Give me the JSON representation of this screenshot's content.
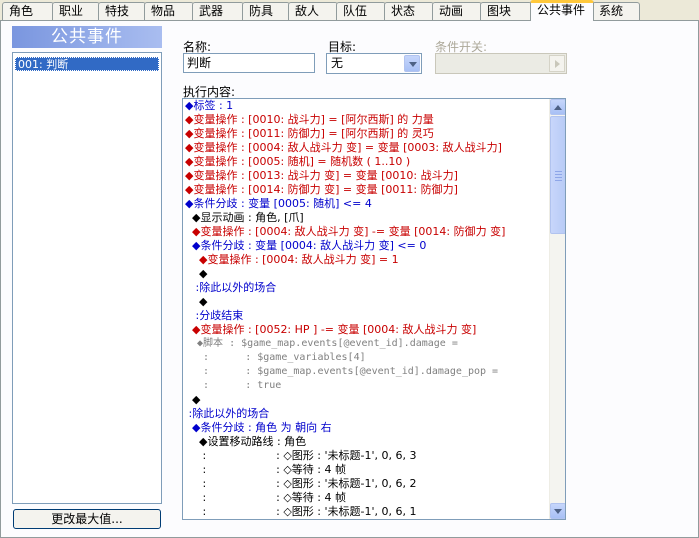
{
  "tabs": [
    {
      "label": "角色"
    },
    {
      "label": "职业"
    },
    {
      "label": "特技"
    },
    {
      "label": "物品"
    },
    {
      "label": "武器"
    },
    {
      "label": "防具"
    },
    {
      "label": "敌人"
    },
    {
      "label": "队伍"
    },
    {
      "label": "状态"
    },
    {
      "label": "动画"
    },
    {
      "label": "图块"
    },
    {
      "label": "公共事件"
    },
    {
      "label": "系统"
    }
  ],
  "active_tab": "公共事件",
  "sidebar": {
    "title": "公共事件",
    "items": [
      {
        "label": "001: 判断"
      }
    ],
    "change_max_button": "更改最大值..."
  },
  "form": {
    "name_label": "名称:",
    "name_value": "判断",
    "target_label": "目标:",
    "target_value": "无",
    "switch_label": "条件开关:",
    "switch_value": "",
    "content_label": "执行内容:"
  },
  "event_commands": [
    {
      "color": "blue",
      "text": "◆标签 : 1"
    },
    {
      "color": "red",
      "text": "◆变量操作 : [0010: 战斗力] = [阿尔西斯] 的 力量"
    },
    {
      "color": "red",
      "text": "◆变量操作 : [0011: 防御力] = [阿尔西斯] 的 灵巧"
    },
    {
      "color": "red",
      "text": "◆变量操作 : [0004: 敌人战斗力 变] = 变量 [0003: 敌人战斗力]"
    },
    {
      "color": "red",
      "text": "◆变量操作 : [0005: 随机] = 随机数 ( 1..10 )"
    },
    {
      "color": "red",
      "text": "◆变量操作 : [0013: 战斗力 变] = 变量 [0010: 战斗力]"
    },
    {
      "color": "red",
      "text": "◆变量操作 : [0014: 防御力 变] = 变量 [0011: 防御力]"
    },
    {
      "color": "blue",
      "text": "◆条件分歧 : 变量 [0005: 随机] <= 4"
    },
    {
      "color": "black",
      "text": "  ◆显示动画 : 角色, [爪]"
    },
    {
      "color": "red",
      "text": "  ◆变量操作 : [0004: 敌人战斗力 变] -= 变量 [0014: 防御力 变]"
    },
    {
      "color": "blue",
      "text": "  ◆条件分歧 : 变量 [0004: 敌人战斗力 变] <= 0"
    },
    {
      "color": "red",
      "text": "    ◆变量操作 : [0004: 敌人战斗力 变] = 1"
    },
    {
      "color": "black",
      "text": "    ◆"
    },
    {
      "color": "blue",
      "text": "   :除此以外的场合"
    },
    {
      "color": "black",
      "text": "    ◆"
    },
    {
      "color": "blue",
      "text": "   :分歧结束"
    },
    {
      "color": "red",
      "text": "  ◆变量操作 : [0052: HP ] -= 变量 [0004: 敌人战斗力 变]"
    },
    {
      "color": "gray",
      "text": "  ◆脚本 : $game_map.events[@event_id].damage ="
    },
    {
      "color": "gray",
      "text": "   :      : $game_variables[4]"
    },
    {
      "color": "gray",
      "text": "   :      : $game_map.events[@event_id].damage_pop ="
    },
    {
      "color": "gray",
      "text": "   :      : true"
    },
    {
      "color": "black",
      "text": "  ◆"
    },
    {
      "color": "blue",
      "text": " :除此以外的场合"
    },
    {
      "color": "blue",
      "text": "  ◆条件分歧 : 角色 为 朝向 右"
    },
    {
      "color": "black",
      "text": "    ◆设置移动路线 : 角色"
    },
    {
      "color": "black",
      "text": "     :                    : ◇图形 : '未标题-1', 0, 6, 3"
    },
    {
      "color": "black",
      "text": "     :                    : ◇等待 : 4 帧"
    },
    {
      "color": "black",
      "text": "     :                    : ◇图形 : '未标题-1', 0, 6, 2"
    },
    {
      "color": "black",
      "text": "     :                    : ◇等待 : 4 帧"
    },
    {
      "color": "black",
      "text": "     :                    : ◇图形 : '未标题-1', 0, 6, 1"
    }
  ],
  "colors": {
    "list_selection": "#316ac5",
    "header_gradient_start": "#7a96df",
    "tab_highlight": "#ffc83c",
    "command_blue": "#0000cc",
    "command_red": "#c80000",
    "command_gray": "#808080"
  },
  "icons": {
    "target_dropdown": "chevron-down-icon",
    "switch_button": "chevron-right-icon",
    "scroll_up": "arrow-up-icon",
    "scroll_down": "arrow-down-icon"
  }
}
